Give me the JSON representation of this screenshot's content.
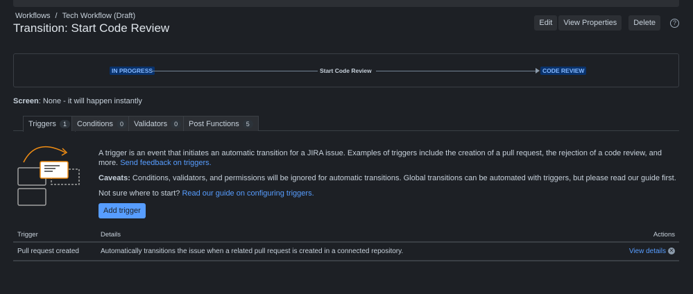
{
  "breadcrumb": [
    "Workflows",
    "Tech Workflow (Draft)"
  ],
  "title": "Transition: Start Code Review",
  "actions": {
    "edit": "Edit",
    "view_properties": "View Properties",
    "delete": "Delete",
    "help": "?"
  },
  "flow": {
    "from": "IN PROGRESS",
    "transition": "Start Code Review",
    "to": "CODE REVIEW"
  },
  "screen": {
    "label": "Screen",
    "value": ": None - it will happen instantly"
  },
  "tabs": [
    {
      "label": "Triggers",
      "count": "1"
    },
    {
      "label": "Conditions",
      "count": "0"
    },
    {
      "label": "Validators",
      "count": "0"
    },
    {
      "label": "Post Functions",
      "count": "5"
    }
  ],
  "intro": {
    "text": "A trigger is an event that initiates an automatic transition for a JIRA issue. Examples of triggers include the creation of a pull request, the rejection of a code review, and more. ",
    "feedback_link": "Send feedback on triggers.",
    "caveats_label": "Caveats:",
    "caveats_text": " Conditions, validators, and permissions will be ignored for automatic transitions. Global transitions can be automated with triggers, but please read our guide first.",
    "start_text": "Not sure where to start? ",
    "guide_link": "Read our guide on configuring triggers."
  },
  "add_trigger": "Add trigger",
  "table": {
    "headers": {
      "trigger": "Trigger",
      "details": "Details",
      "actions": "Actions"
    },
    "rows": [
      {
        "trigger": "Pull request created",
        "details": "Automatically transitions the issue when a related pull request is created in a connected repository.",
        "action": "View details"
      }
    ]
  }
}
